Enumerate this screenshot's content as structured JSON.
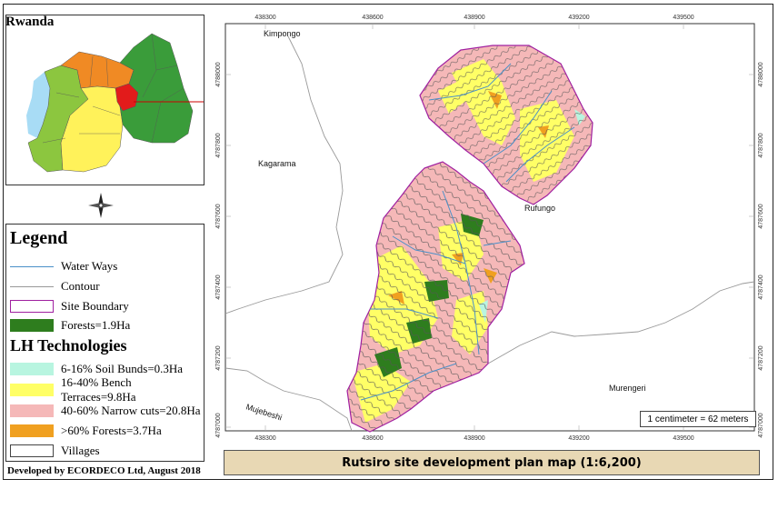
{
  "inset": {
    "title": "Rwanda"
  },
  "legend": {
    "title": "Legend",
    "items": [
      {
        "label": "Water Ways",
        "color": "#4a90c8"
      },
      {
        "label": "Contour",
        "color": "#999999"
      },
      {
        "label": "Site Boundary",
        "color": "#a020a0"
      },
      {
        "label": "Forests=1.9Ha",
        "color": "#2e7d1e"
      }
    ],
    "lh_title": "LH Technologies",
    "lh_items": [
      {
        "label": "6-16% Soil Bunds=0.3Ha",
        "color": "#b8f5e0"
      },
      {
        "label": "16-40% Bench Terraces=9.8Ha",
        "color": "#ffff66"
      },
      {
        "label": "40-60% Narrow cuts=20.8Ha",
        "color": "#f5b8b8"
      },
      {
        "label": ">60% Forests=3.7Ha",
        "color": "#f0a020"
      },
      {
        "label": "Villages",
        "color": "#ffffff"
      }
    ]
  },
  "credit": "Developed by ECORDECO Ltd, August 2018",
  "map": {
    "x_ticks": [
      "438300",
      "438600",
      "438900",
      "439200",
      "439500"
    ],
    "y_ticks": [
      "4788000",
      "4787800",
      "4787600",
      "4787400",
      "4787200",
      "4787000"
    ],
    "villages": [
      "Kimpongo",
      "Kagarama",
      "Rufungo",
      "Mujebeshi",
      "Murengeri"
    ]
  },
  "scale": "1 centimeter = 62 meters",
  "title": "Rutsiro site development plan map (1:6,200)"
}
